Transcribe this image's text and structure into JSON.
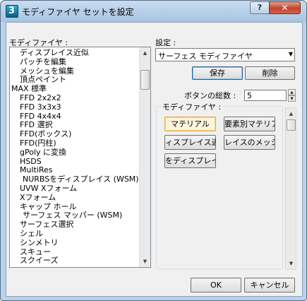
{
  "window": {
    "title": "モディファイヤ セットを設定",
    "help_label": "?",
    "close_label": "✕"
  },
  "left": {
    "label": "モディファイヤ :",
    "items": [
      "ディスプレイス近似",
      "パッチを編集",
      "メッシュを編集",
      "頂点ペイント",
      "MAX 標準",
      "FFD 2x2x2",
      "FFD 3x3x3",
      "FFD 4x4x4",
      "FFD 選択",
      "FFD(ボックス)",
      "FFD(円柱)",
      "gPoly に変換",
      "HSDS",
      "MultiRes",
      "NURBSをディスプレイス (WSM)",
      "UVW Xフォーム",
      "Xフォーム",
      "キャップ ホール",
      "サーフェス マッパー (WSM)",
      "サーフェス選択",
      "シェル",
      "シンメトリ",
      "スキュー",
      "スクイーズ"
    ],
    "indents": [
      1,
      1,
      1,
      1,
      0,
      1,
      1,
      1,
      1,
      1,
      1,
      1,
      1,
      1,
      2,
      1,
      1,
      1,
      2,
      1,
      1,
      1,
      1,
      1
    ]
  },
  "right": {
    "settings_label": "設定 :",
    "combo_value": "サーフェス モディファイヤ",
    "save_label": "保存",
    "delete_label": "削除",
    "total_label": "ボタンの総数 :",
    "total_value": "5",
    "group_label": "モディファイヤ :",
    "modifier_buttons": [
      "マテリアル",
      "要素別マテリアル",
      "ィスプレイス近似",
      "レイスのメッシュ",
      "をディスプレイス"
    ]
  },
  "footer": {
    "ok_label": "OK",
    "cancel_label": "キャンセル"
  }
}
